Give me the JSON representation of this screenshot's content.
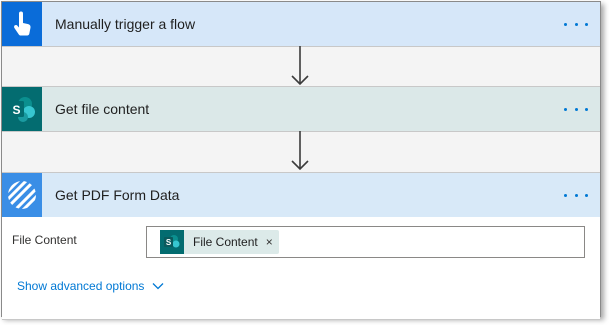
{
  "flow": {
    "steps": [
      {
        "title": "Manually trigger a flow",
        "icon": "touch-trigger-icon",
        "accent": "#0a6cd9"
      },
      {
        "title": "Get file content",
        "icon": "sharepoint-icon",
        "accent": "#036c70"
      },
      {
        "title": "Get PDF Form Data",
        "icon": "encodian-stripes-icon",
        "accent": "#3a8ee6"
      }
    ],
    "form": {
      "field_label": "File Content",
      "token_label": "File Content",
      "token_remove": "×",
      "show_advanced": "Show advanced options"
    },
    "colors": {
      "link": "#0078d4",
      "header_blue": "#d6e7f9",
      "header_teal": "#dbe8e8"
    }
  }
}
